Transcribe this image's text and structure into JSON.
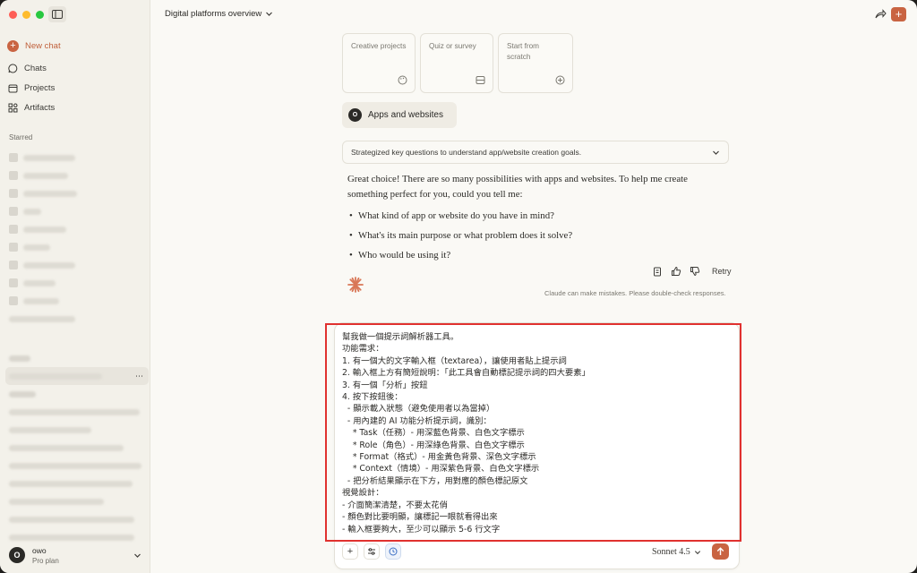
{
  "window": {
    "title": "Digital platforms overview"
  },
  "sidebar": {
    "new_chat": "New chat",
    "items": [
      {
        "label": "Chats",
        "icon": "chat-bubble-icon"
      },
      {
        "label": "Projects",
        "icon": "folder-icon"
      },
      {
        "label": "Artifacts",
        "icon": "artifacts-grid-icon"
      }
    ],
    "starred_title": "Starred",
    "user": {
      "initials": "O",
      "name": "owo",
      "plan": "Pro plan"
    }
  },
  "cards": [
    {
      "label": "Creative projects",
      "icon": "palette-icon"
    },
    {
      "label": "Quiz or survey",
      "icon": "list-icon"
    },
    {
      "label": "Start from scratch",
      "icon": "plus-circle-icon"
    }
  ],
  "selected": {
    "label": "Apps and websites",
    "initials": "O"
  },
  "summary": {
    "text": "Strategized key questions to understand app/website creation goals."
  },
  "response": {
    "intro": "Great choice! There are so many possibilities with apps and websites. To help me create something perfect for you, could you tell me:",
    "bullets": [
      "What kind of app or website do you have in mind?",
      "What's its main purpose or what problem does it solve?",
      "Who would be using it?"
    ]
  },
  "actions": {
    "retry": "Retry"
  },
  "disclaimer": "Claude can make mistakes. Please double-check responses.",
  "composer": {
    "text": "幫我做一個提示詞解析器工具。\n功能需求：\n1. 有一個大的文字輸入框（textarea），讓使用者貼上提示詞\n2. 輸入框上方有簡短說明：「此工具會自動標記提示詞的四大要素」\n3. 有一個「分析」按鈕\n4. 按下按鈕後：\n  - 顯示載入狀態（避免使用者以為當掉）\n  - 用內建的 AI 功能分析提示詞，識別：\n    * Task（任務）- 用深藍色背景、白色文字標示\n    * Role（角色）- 用深綠色背景、白色文字標示\n    * Format（格式）- 用金黃色背景、深色文字標示\n    * Context（情境）- 用深紫色背景、白色文字標示\n  - 把分析結果顯示在下方，用對應的顏色標記原文\n視覺設計：\n- 介面簡潔清楚，不要太花俏\n- 顏色對比要明顯，讓標記一眼就看得出來\n- 輸入框要夠大，至少可以顯示 5-6 行文字",
    "model": "Sonnet 4.5"
  },
  "colors": {
    "accent": "#c96442",
    "highlight": "#e0312f",
    "background": "#faf9f5"
  }
}
